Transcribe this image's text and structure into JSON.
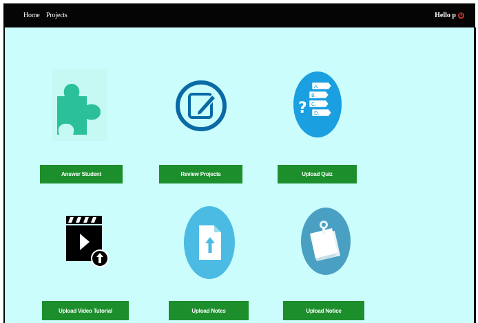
{
  "navbar": {
    "links": [
      {
        "label": "Home"
      },
      {
        "label": "Projects"
      }
    ],
    "greeting": "Hello p",
    "logout_icon": "logout-power-icon",
    "logout_color": "#e53935"
  },
  "colors": {
    "navbar_bg": "#050505",
    "content_bg": "#ccfdfd",
    "button_bg": "#1c8f2c",
    "button_text": "#ffffff"
  },
  "dashboard": {
    "tiles": [
      {
        "icon": "puzzle-piece-icon",
        "button_label": "Answer Student"
      },
      {
        "icon": "edit-document-icon",
        "button_label": "Review Projects"
      },
      {
        "icon": "quiz-options-icon",
        "button_label": "Upload Quiz"
      },
      {
        "icon": "video-upload-icon",
        "button_label": "Upload Video Tutorial"
      },
      {
        "icon": "upload-file-icon",
        "button_label": "Upload Notes"
      },
      {
        "icon": "pinned-notice-icon",
        "button_label": "Upload Notice"
      }
    ]
  }
}
